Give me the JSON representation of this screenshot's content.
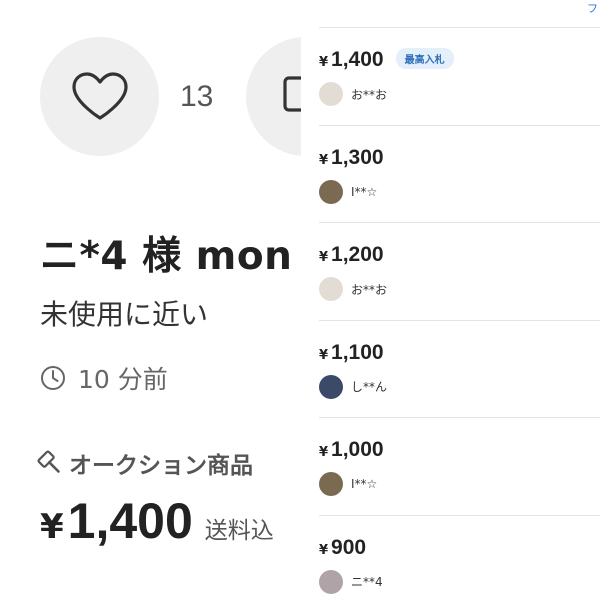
{
  "left": {
    "like_count": "13",
    "title": "ニ*4 様 mon",
    "condition": "未使用に近い",
    "time": "10 分前",
    "auction_label": "オークション商品",
    "price": {
      "yen": "¥",
      "amount": "1,400",
      "shipping": "送料込"
    }
  },
  "right": {
    "top_link": "フ",
    "bids": [
      {
        "yen": "¥",
        "price": "1,400",
        "badge": "最高入札",
        "name": "お**お",
        "avatar_color": "#e3dcd4"
      },
      {
        "yen": "¥",
        "price": "1,300",
        "badge": "",
        "name": "I**☆",
        "avatar_color": "#7a6a52"
      },
      {
        "yen": "¥",
        "price": "1,200",
        "badge": "",
        "name": "お**お",
        "avatar_color": "#e3dcd4"
      },
      {
        "yen": "¥",
        "price": "1,100",
        "badge": "",
        "name": "し**ん",
        "avatar_color": "#3c4a6a"
      },
      {
        "yen": "¥",
        "price": "1,000",
        "badge": "",
        "name": "I**☆",
        "avatar_color": "#7a6a52"
      },
      {
        "yen": "¥",
        "price": "900",
        "badge": "",
        "name": "ニ**4",
        "avatar_color": "#b0a3a8"
      }
    ]
  },
  "colors": {
    "accent": "#2a7ad8",
    "badge_bg": "#e3f0fc",
    "badge_text": "#2f6fb8",
    "circle_bg": "#efefef"
  }
}
